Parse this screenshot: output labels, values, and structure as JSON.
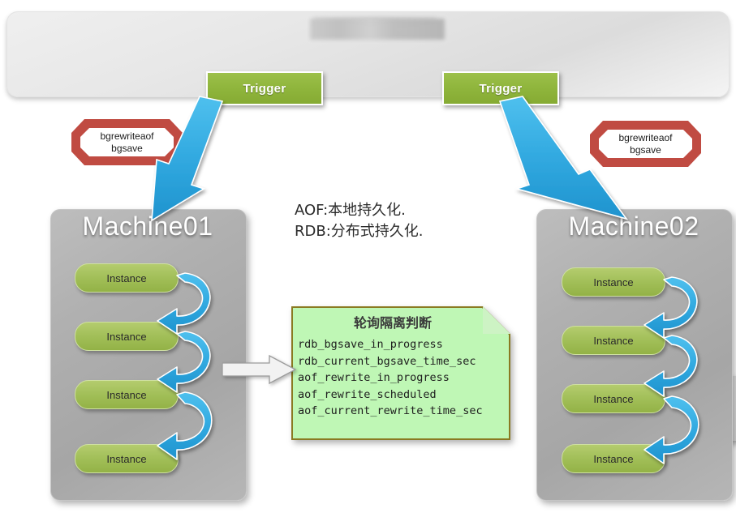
{
  "banner": {
    "title_redacted": true,
    "title_text": ""
  },
  "triggers": [
    {
      "label": "Trigger"
    },
    {
      "label": "Trigger"
    }
  ],
  "callouts": [
    {
      "line1": "bgrewriteaof",
      "line2": "bgsave"
    },
    {
      "line1": "bgrewriteaof",
      "line2": "bgsave"
    }
  ],
  "gray_note": {
    "lines": [
      "AOF:本地持久化.",
      "RDB:分布式持久化."
    ]
  },
  "green_note": {
    "title": "轮询隔离判断",
    "lines": [
      "rdb_bgsave_in_progress",
      "rdb_current_bgsave_time_sec",
      "aof_rewrite_in_progress",
      "aof_rewrite_scheduled",
      "aof_current_rewrite_time_sec"
    ]
  },
  "machines": [
    {
      "title": "Machine01",
      "instances": [
        {
          "label": "Instance"
        },
        {
          "label": "Instance"
        },
        {
          "label": "Instance"
        },
        {
          "label": "Instance"
        }
      ]
    },
    {
      "title": "Machine02",
      "instances": [
        {
          "label": "Instance"
        },
        {
          "label": "Instance"
        },
        {
          "label": "Instance"
        },
        {
          "label": "Instance"
        }
      ]
    }
  ],
  "colors": {
    "trigger_green": "#8fb53c",
    "instance_green": "#a3c05a",
    "callout_red": "#c04b42",
    "machine_gray": "#b0b0b0",
    "note_green": "#bff7b5",
    "note_green_border": "#8a7a22",
    "arrow_blue": "#31a9e0",
    "banner_gray": "#e7e7e7"
  }
}
